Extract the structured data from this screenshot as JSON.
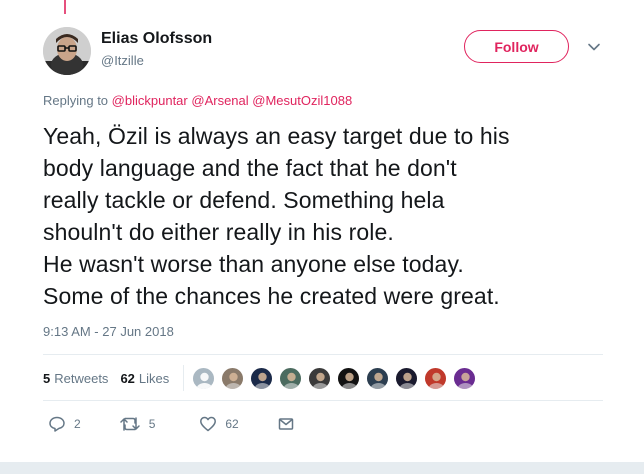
{
  "author": {
    "name": "Elias Olofsson",
    "handle": "@Itzille",
    "follow_label": "Follow"
  },
  "reply_context": {
    "prefix": "Replying to",
    "mentions": [
      "@blickpuntar",
      "@Arsenal",
      "@MesutOzil1088"
    ]
  },
  "tweet_lines": [
    "Yeah, Özil is always an easy target due to his",
    "body language and the fact that he don't",
    "really tackle or defend. Something hela",
    "shouln't do either really in his role.",
    "He wasn't worse than anyone else today.",
    "Some of the chances he created were great."
  ],
  "timestamp": "9:13 AM - 27 Jun 2018",
  "stats": {
    "retweets_count": "5",
    "retweets_label": "Retweets",
    "likes_count": "62",
    "likes_label": "Likes"
  },
  "likers": [
    {
      "icon": "default-avatar",
      "color": "#aab8c2"
    },
    {
      "icon": "user-avatar",
      "color": "#8a7a6a"
    },
    {
      "icon": "user-avatar",
      "color": "#1b2a49"
    },
    {
      "icon": "user-avatar",
      "color": "#4b6b5f"
    },
    {
      "icon": "user-avatar",
      "color": "#3a3a3a"
    },
    {
      "icon": "user-avatar",
      "color": "#121212"
    },
    {
      "icon": "user-avatar",
      "color": "#2c3e50"
    },
    {
      "icon": "user-avatar",
      "color": "#1a1a2e"
    },
    {
      "icon": "user-avatar",
      "color": "#c0392b"
    },
    {
      "icon": "user-avatar",
      "color": "#6a2c91"
    }
  ],
  "actions": {
    "reply_count": "2",
    "retweet_count": "5",
    "like_count": "62"
  },
  "colors": {
    "accent": "#e0245e",
    "muted": "#657786",
    "text": "#14171a",
    "divider": "#e6ecf0"
  }
}
